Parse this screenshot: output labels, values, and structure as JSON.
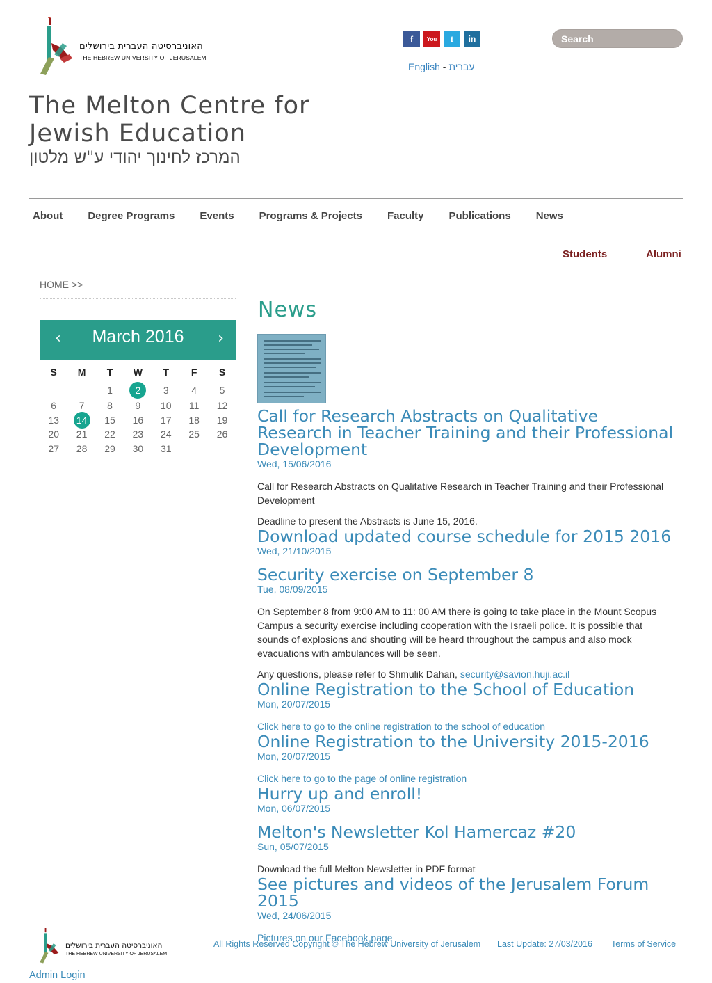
{
  "header": {
    "logo_hebrew": "האוניברסיטה העברית בירושלים",
    "logo_english": "THE HEBREW UNIVERSITY OF JERUSALEM",
    "social": [
      {
        "name": "facebook-icon",
        "glyph": "f"
      },
      {
        "name": "youtube-icon",
        "glyph": "You"
      },
      {
        "name": "twitter-icon",
        "glyph": "t"
      },
      {
        "name": "linkedin-icon",
        "glyph": "in"
      }
    ],
    "lang_english": "English",
    "lang_sep": " - ",
    "lang_hebrew": "עברית",
    "search_placeholder": "Search"
  },
  "site": {
    "title_line1": "The Melton Centre for",
    "title_line2": "Jewish Education",
    "title_hebrew": "המרכז לחינוך יהודי ע\"ש מלטון"
  },
  "nav": [
    "About",
    "Degree Programs",
    "Events",
    "Programs & Projects",
    "Faculty",
    "Publications",
    "News"
  ],
  "quick_links": {
    "students": "Students",
    "alumni": "Alumni"
  },
  "breadcrumb": "HOME >>",
  "calendar": {
    "prev": "‹",
    "next": "›",
    "title": "March 2016",
    "days_of_week": [
      "S",
      "M",
      "T",
      "W",
      "T",
      "F",
      "S"
    ],
    "weeks": [
      [
        "",
        "",
        "1",
        "2",
        "3",
        "4",
        "5"
      ],
      [
        "6",
        "7",
        "8",
        "9",
        "10",
        "11",
        "12"
      ],
      [
        "13",
        "14",
        "15",
        "16",
        "17",
        "18",
        "19"
      ],
      [
        "20",
        "21",
        "22",
        "23",
        "24",
        "25",
        "26"
      ],
      [
        "27",
        "28",
        "29",
        "30",
        "31",
        "",
        ""
      ]
    ],
    "highlighted": [
      "2",
      "14"
    ],
    "highlight_color": "#17a590"
  },
  "news": {
    "heading": "News",
    "items": [
      {
        "title": "Call for Research Abstracts on Qualitative Research in Teacher Training and their Professional Development",
        "date": "Wed, 15/06/2016",
        "paragraphs": [
          "Call for Research Abstracts on Qualitative Research in Teacher Training and their Professional Development",
          "Deadline to present the Abstracts is June 15, 2016."
        ]
      },
      {
        "title": "Download updated course schedule for 2015 2016",
        "date": "Wed, 21/10/2015"
      },
      {
        "title": "Security exercise on September 8",
        "date": "Tue, 08/09/2015",
        "paragraphs": [
          "On September 8 from 9:00 AM to 11: 00 AM there is going to take place in the Mount Scopus Campus a security exercise including cooperation with the Israeli police. It is possible that sounds of explosions and shouting will be heard throughout the campus and also mock evacuations with ambulances will be seen."
        ],
        "contact_text": "Any questions, please refer to Shmulik Dahan, ",
        "contact_email": "security@savion.huji.ac.il"
      },
      {
        "title": "Online Registration to the School of Education",
        "date": "Mon, 20/07/2015",
        "link": "Click here to go to the online registration to the school of education"
      },
      {
        "title": "Online Registration to the University 2015-2016",
        "date": "Mon, 20/07/2015",
        "link": "Click here to go to the page of online registration"
      },
      {
        "title": "Hurry up and enroll!",
        "date": "Mon, 06/07/2015"
      },
      {
        "title": "Melton's Newsletter Kol Hamercaz #20",
        "date": "Sun, 05/07/2015",
        "text": "Download the full Melton Newsletter in PDF format"
      },
      {
        "title": "See pictures and videos of the Jerusalem Forum 2015",
        "date": "Wed, 24/06/2015",
        "link": "Pictures on our Facebook page"
      }
    ]
  },
  "footer": {
    "copyright": "All Rights Reserved Copyright © The Hebrew University of Jerusalem",
    "last_update": "Last Update: 27/03/2016",
    "terms": "Terms of Service",
    "admin_login": "Admin Login"
  },
  "colors": {
    "accent": "#2a9d8b",
    "link": "#3b8bb8",
    "quick_link": "#7a1f1f"
  }
}
